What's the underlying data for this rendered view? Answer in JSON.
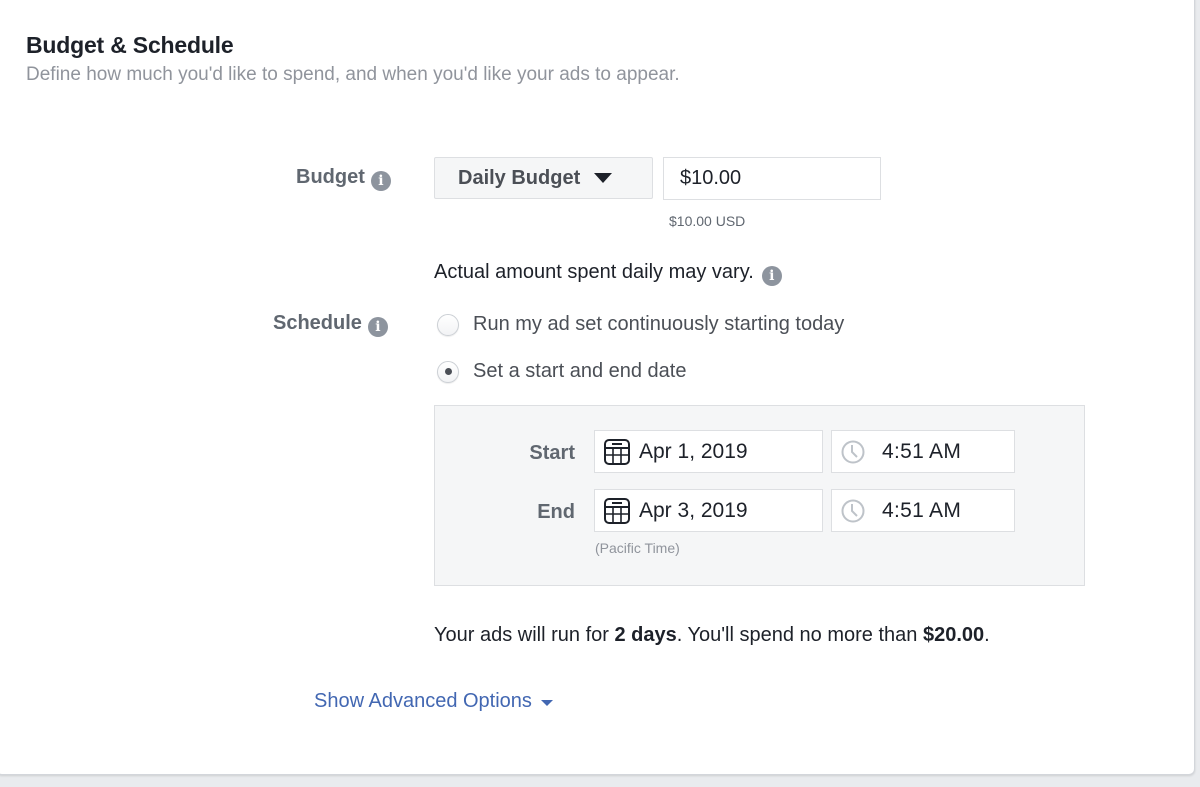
{
  "section": {
    "title": "Budget & Schedule",
    "subtitle": "Define how much you'd like to spend, and when you'd like your ads to appear."
  },
  "budget": {
    "label": "Budget",
    "info_icon": "info-icon",
    "type_select": {
      "selected": "Daily Budget",
      "icon": "caret-down-icon"
    },
    "amount_value": "$10.00",
    "amount_currency_note": "$10.00 USD",
    "vary_note": "Actual amount spent daily may vary."
  },
  "schedule": {
    "label": "Schedule",
    "info_icon": "info-icon",
    "options": [
      {
        "label": "Run my ad set continuously starting today",
        "selected": false
      },
      {
        "label": "Set a start and end date",
        "selected": true
      }
    ],
    "start": {
      "label": "Start",
      "date": "Apr 1, 2019",
      "time": "4:51 AM",
      "date_icon": "calendar-icon",
      "time_icon": "clock-icon"
    },
    "end": {
      "label": "End",
      "date": "Apr 3, 2019",
      "time": "4:51 AM",
      "date_icon": "calendar-icon",
      "time_icon": "clock-icon"
    },
    "timezone_note": "(Pacific Time)"
  },
  "summary": {
    "prefix": "Your ads will run for ",
    "duration": "2 days",
    "middle": ". You'll spend no more than ",
    "max_spend": "$20.00",
    "suffix": "."
  },
  "advanced_link": {
    "label": "Show Advanced Options",
    "icon": "caret-down-icon"
  },
  "colors": {
    "link": "#4267b2",
    "label_gray": "#606770",
    "muted": "#90949c",
    "text": "#1d2129"
  }
}
